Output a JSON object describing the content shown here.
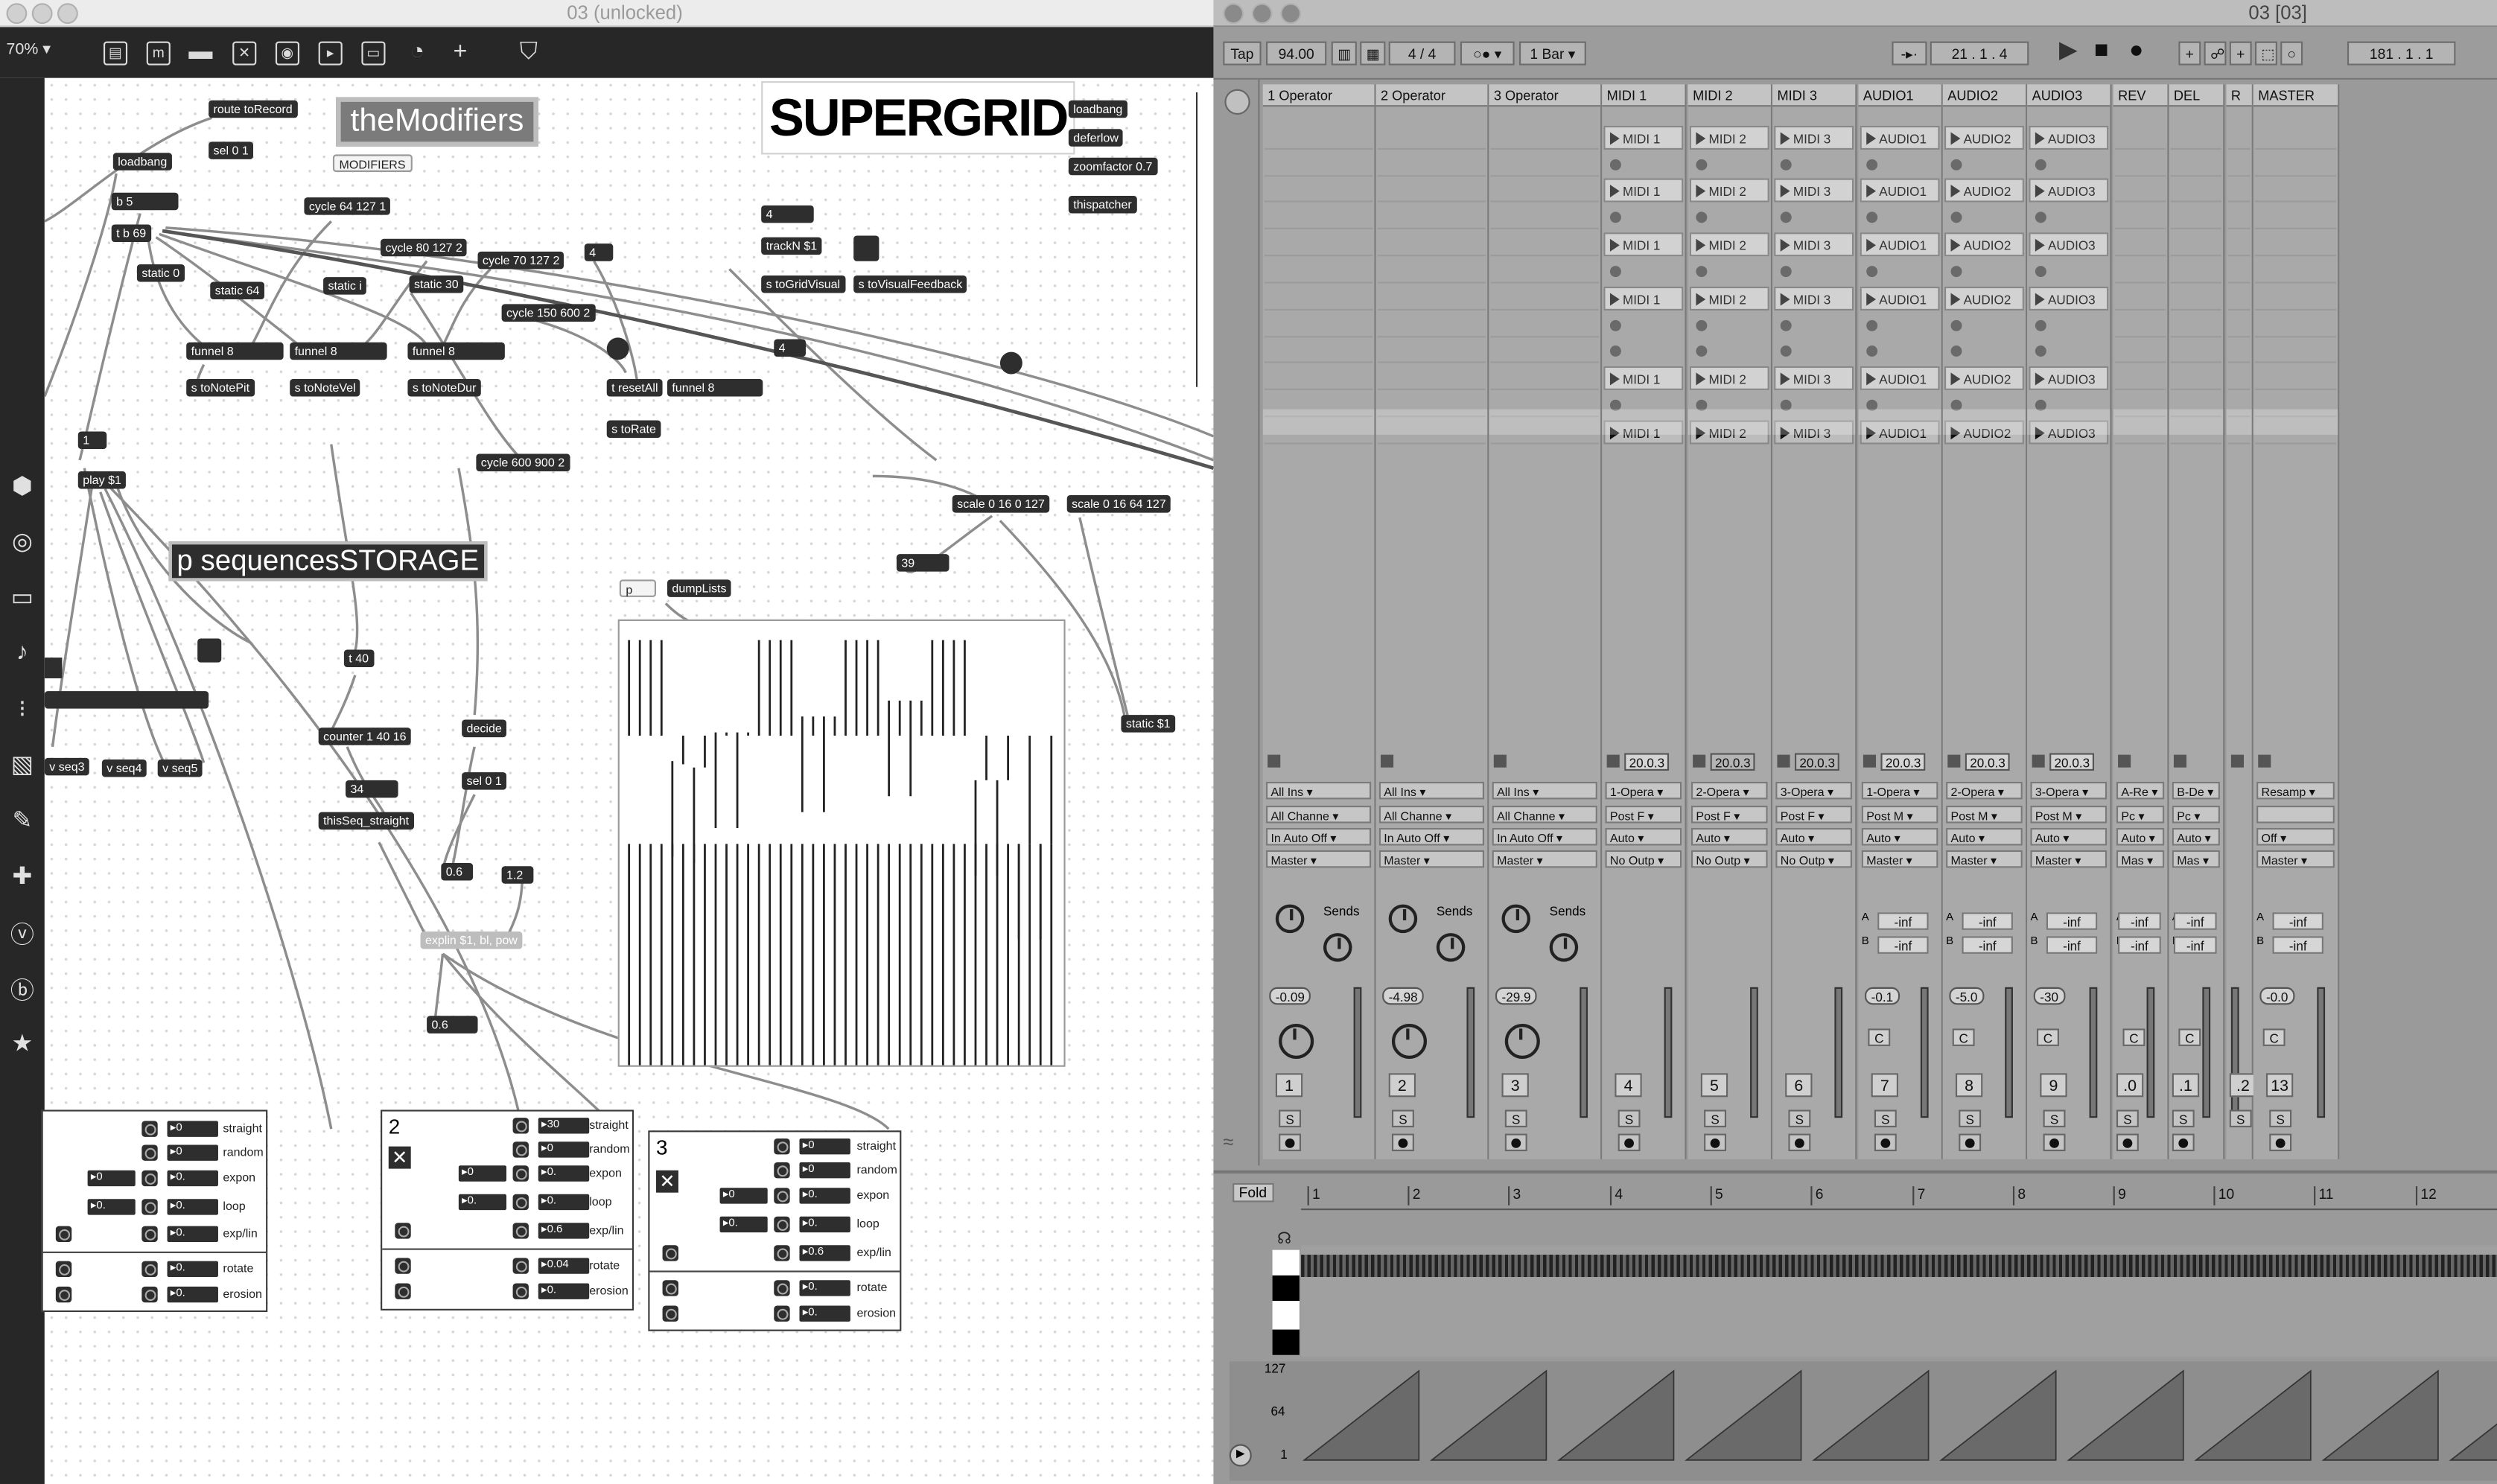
{
  "max": {
    "window_title": "03 (unlocked)",
    "zoom": "70%",
    "big_titles": {
      "modifiers": "theModifiers",
      "supergrid": "SUPERGRID",
      "sequences": "p sequencesSTORAGE"
    },
    "modifiers_label": "MODIFIERS",
    "objects": {
      "route_toRecord": "route toRecord",
      "sel01_a": "sel 0 1",
      "loadbang_a": "loadbang",
      "b5": "b 5",
      "t_b69": "t b 69",
      "cycle64": "cycle 64 127 1",
      "cycle80": "cycle 80 127 2",
      "cycle70": "cycle 70 127 2",
      "four_a": "4",
      "static0": "static 0",
      "static64": "static 64",
      "static_i": "static i",
      "static30": "static 30",
      "cycle150": "cycle 150 600 2",
      "funnel_a": "funnel 8",
      "funnel_b": "funnel 8",
      "funnel_c": "funnel 8",
      "s_toNotePit": "s toNotePit",
      "s_toNoteVel": "s toNoteVel",
      "s_toNoteDur": "s toNoteDur",
      "t_resetAll": "t resetAll",
      "funnel_d": "funnel 8",
      "four_b": "4",
      "s_toRate": "s toRate",
      "one": "1",
      "play": "play $1",
      "cycle600": "cycle 600 900 2",
      "loadbang_b": "loadbang",
      "deferlow": "deferlow",
      "zoomfactor": "zoomfactor 0.7",
      "thispatcher": "thispatcher",
      "four_c": "4",
      "trackN": "trackN $1",
      "s_toGridVisual": "s toGridVisual",
      "s_toVisualFeedback": "s toVisualFeedback",
      "scale_a": "scale 0 16 0 127",
      "scale_b": "scale 0 16 64 127",
      "n39": "39",
      "p_obj": "p",
      "dumpLists": "dumpLists",
      "t40": "t 40",
      "decide": "decide",
      "counter": "counter 1 40 16",
      "sel01_b": "sel 0 1",
      "n34": "34",
      "thisSeq": "thisSeq_straight",
      "v0_6": "0.6",
      "v1_2": "1.2",
      "expline": "explin $1, bl, pow",
      "v0_6b": "0.6",
      "static1": "static $1",
      "vseq3": "v seq3",
      "vseq4": "v seq4",
      "vseq5": "v seq5"
    },
    "panels": [
      {
        "num": "",
        "rows": [
          {
            "label": "straight",
            "val": "0"
          },
          {
            "label": "random",
            "val": "0"
          },
          {
            "label": "expon",
            "val": "0."
          },
          {
            "label": "loop",
            "val": "0."
          },
          {
            "label": "exp/lin",
            "val": "0."
          },
          {
            "label": "rotate",
            "val": "0."
          },
          {
            "label": "erosion",
            "val": "0."
          }
        ]
      },
      {
        "num": "2",
        "rows": [
          {
            "label": "straight",
            "val": "30"
          },
          {
            "label": "random",
            "val": "0"
          },
          {
            "label": "expon",
            "val": "0."
          },
          {
            "label": "loop",
            "val": "0."
          },
          {
            "label": "exp/lin",
            "val": "0.6"
          },
          {
            "label": "rotate",
            "val": "0.04"
          },
          {
            "label": "erosion",
            "val": "0."
          }
        ]
      },
      {
        "num": "3",
        "rows": [
          {
            "label": "straight",
            "val": "0"
          },
          {
            "label": "random",
            "val": "0"
          },
          {
            "label": "expon",
            "val": "0."
          },
          {
            "label": "loop",
            "val": "0."
          },
          {
            "label": "exp/lin",
            "val": "0.6"
          },
          {
            "label": "rotate",
            "val": "0."
          },
          {
            "label": "erosion",
            "val": "0."
          }
        ]
      }
    ],
    "panel_extra_vals": {
      "p0_expon2": "0",
      "p1_expon2": "0",
      "p1_loop2": "0.",
      "p2_expon2": "0",
      "p2_loop2": "0."
    }
  },
  "live": {
    "window_title": "03  [03]",
    "tap": "Tap",
    "tempo": "94.00",
    "signature": "4 / 4",
    "quantize": "1 Bar",
    "position": "21 .  1 .  4",
    "end_position": "181 .  1 .  1",
    "fold": "Fold",
    "tracks": [
      {
        "name": "1 Operator",
        "clip": "",
        "io": [
          "All Ins",
          "All Channe",
          "In  Auto  Off",
          "Master"
        ],
        "vol": "-0.09",
        "num": "1"
      },
      {
        "name": "2 Operator",
        "clip": "",
        "io": [
          "All Ins",
          "All Channe",
          "In  Auto  Off",
          "Master"
        ],
        "vol": "-4.98",
        "num": "2"
      },
      {
        "name": "3 Operator",
        "clip": "",
        "io": [
          "All Ins",
          "All Channe",
          "In  Auto  Off",
          "Master"
        ],
        "vol": "-29.9",
        "num": "3"
      },
      {
        "name": "MIDI 1",
        "clip": "MIDI 1",
        "io": [
          "1-Opera",
          "Post F",
          "Auto",
          "No Outp"
        ],
        "vol": "",
        "num": "4"
      },
      {
        "name": "MIDI 2",
        "clip": "MIDI 2",
        "io": [
          "2-Opera",
          "Post F",
          "Auto",
          "No Outp"
        ],
        "vol": "",
        "num": "5"
      },
      {
        "name": "MIDI 3",
        "clip": "MIDI 3",
        "io": [
          "3-Opera",
          "Post F",
          "Auto",
          "No Outp"
        ],
        "vol": "",
        "num": "6"
      },
      {
        "name": "AUDIO1",
        "clip": "AUDIO1",
        "io": [
          "1-Opera",
          "Post M",
          "Auto",
          "Master"
        ],
        "vol": "-0.1",
        "num": "7"
      },
      {
        "name": "AUDIO2",
        "clip": "AUDIO2",
        "io": [
          "2-Opera",
          "Post M",
          "Auto",
          "Master"
        ],
        "vol": "-5.0",
        "num": "8"
      },
      {
        "name": "AUDIO3",
        "clip": "AUDIO3",
        "io": [
          "3-Opera",
          "Post M",
          "Auto",
          "Master"
        ],
        "vol": "-30",
        "num": "9"
      },
      {
        "name": "REV",
        "clip": "",
        "io": [
          "A-Re",
          "Pc",
          "Auto",
          "Mas"
        ],
        "vol": "",
        "num": ".0"
      },
      {
        "name": "DEL",
        "clip": "",
        "io": [
          "B-De",
          "Pc",
          "Auto",
          "Mas"
        ],
        "vol": "",
        "num": ".1"
      },
      {
        "name": "R",
        "clip": "",
        "io": [
          "",
          "",
          "",
          ""
        ],
        "vol": "",
        "num": ".2"
      },
      {
        "name": "MASTER",
        "clip": "",
        "io": [
          "Resamp",
          "",
          "Off",
          "Master"
        ],
        "vol": "-0.0",
        "num": "13"
      }
    ],
    "midi_clip_vals": [
      "20.0.3",
      "20.0.3",
      "20.0.3",
      "20.0.3",
      "20.0.3",
      "20.0.3"
    ],
    "sends_label": "Sends",
    "send_inf": "-inf",
    "send_a": "A",
    "send_b": "B",
    "s": "S",
    "c": "C",
    "ruler": [
      "1",
      "2",
      "3",
      "4",
      "5",
      "6",
      "7",
      "8",
      "9",
      "10",
      "11",
      "12"
    ],
    "env_labels": [
      "127",
      "64",
      "1"
    ]
  }
}
